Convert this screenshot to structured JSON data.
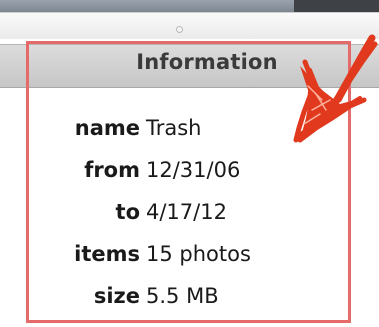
{
  "panel": {
    "header": "Information",
    "fields": [
      {
        "label": "name",
        "value": "Trash"
      },
      {
        "label": "from",
        "value": "12/31/06"
      },
      {
        "label": "to",
        "value": "4/17/12"
      },
      {
        "label": "items",
        "value": "15 photos"
      },
      {
        "label": "size",
        "value": "5.5 MB"
      }
    ]
  },
  "annotation": {
    "color": "#e0391d",
    "box_color": "#e56b6b",
    "arrow_icon": "hand-drawn-arrow-icon"
  }
}
